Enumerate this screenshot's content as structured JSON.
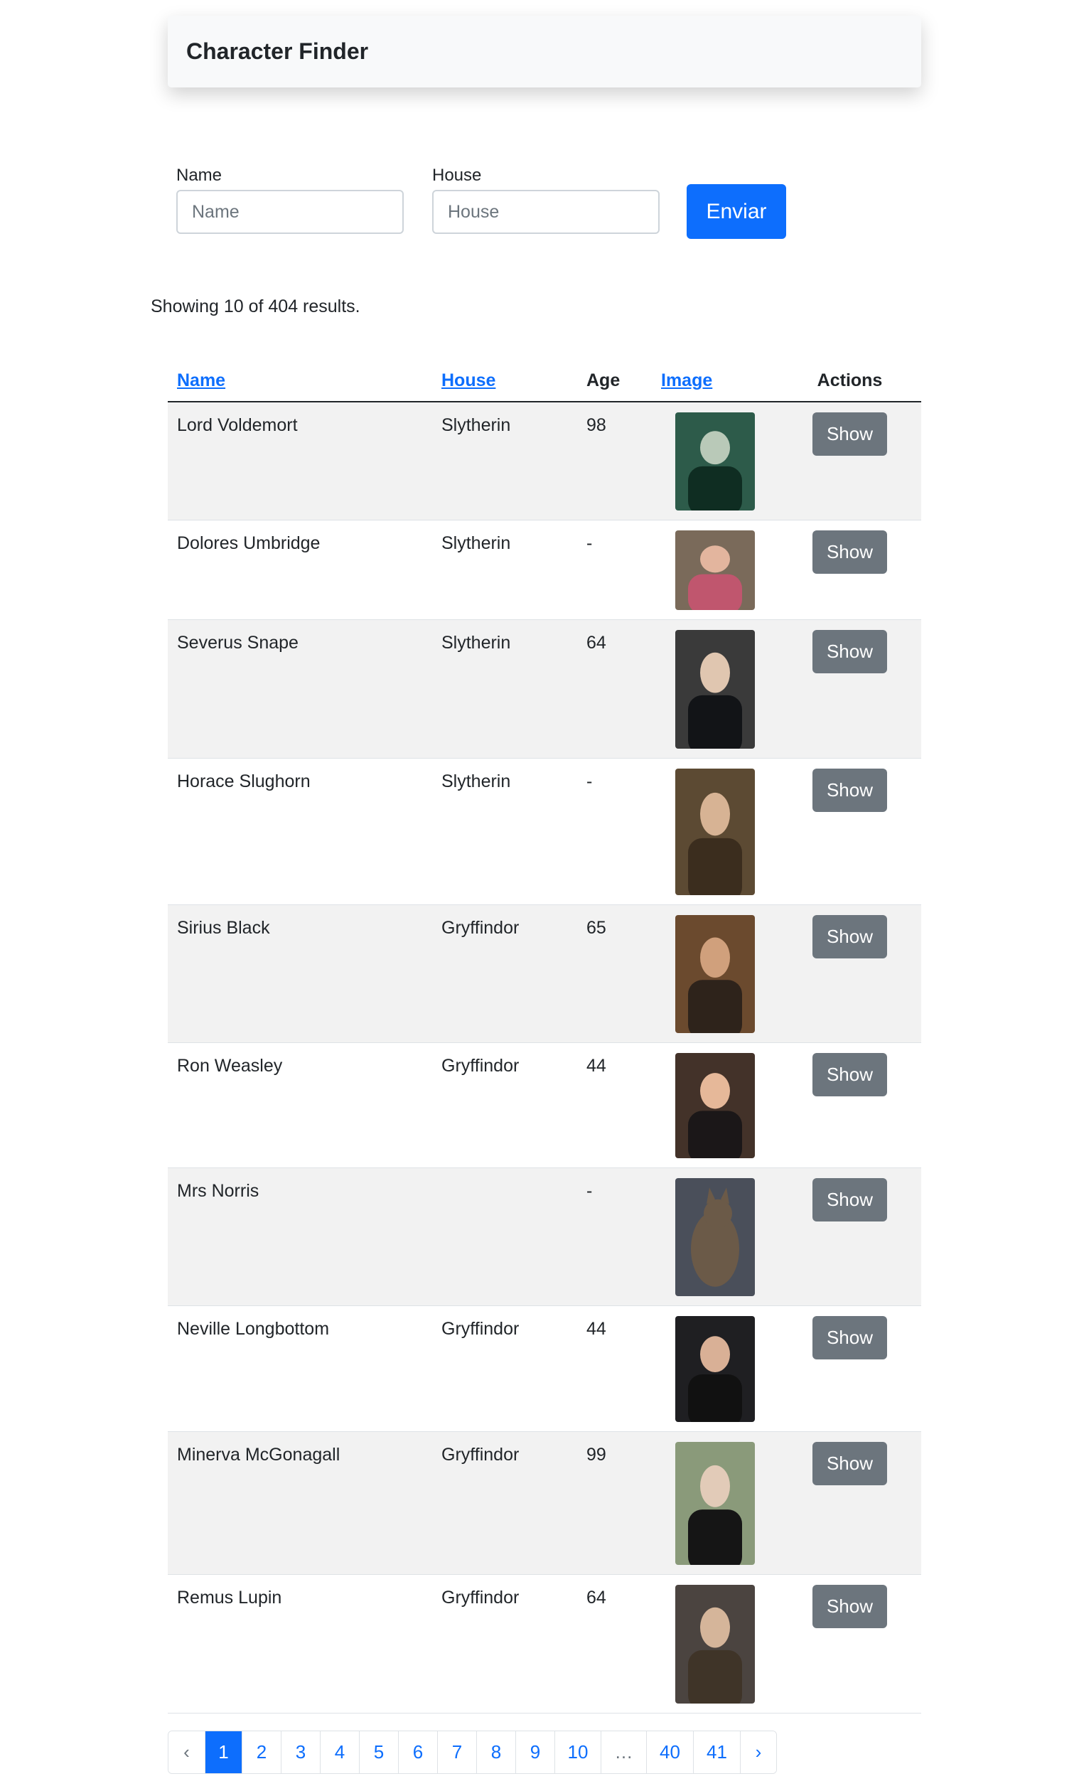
{
  "navbar": {
    "brand": "Character Finder"
  },
  "search": {
    "name_label": "Name",
    "name_placeholder": "Name",
    "house_label": "House",
    "house_placeholder": "House",
    "submit_label": "Enviar"
  },
  "results": {
    "summary": "Showing 10 of 404 results."
  },
  "table": {
    "headers": {
      "name": "Name",
      "house": "House",
      "age": "Age",
      "image": "Image",
      "actions": "Actions"
    },
    "rows": [
      {
        "name": "Lord Voldemort",
        "house": "Slytherin",
        "age": "98",
        "action": "Show",
        "portrait_icon": "character-portrait"
      },
      {
        "name": "Dolores Umbridge",
        "house": "Slytherin",
        "age": "-",
        "action": "Show",
        "portrait_icon": "character-portrait"
      },
      {
        "name": "Severus Snape",
        "house": "Slytherin",
        "age": "64",
        "action": "Show",
        "portrait_icon": "character-portrait"
      },
      {
        "name": "Horace Slughorn",
        "house": "Slytherin",
        "age": "-",
        "action": "Show",
        "portrait_icon": "character-portrait"
      },
      {
        "name": "Sirius Black",
        "house": "Gryffindor",
        "age": "65",
        "action": "Show",
        "portrait_icon": "character-portrait"
      },
      {
        "name": "Ron Weasley",
        "house": "Gryffindor",
        "age": "44",
        "action": "Show",
        "portrait_icon": "character-portrait"
      },
      {
        "name": "Mrs Norris",
        "house": "",
        "age": "-",
        "action": "Show",
        "portrait_icon": "cat-portrait"
      },
      {
        "name": "Neville Longbottom",
        "house": "Gryffindor",
        "age": "44",
        "action": "Show",
        "portrait_icon": "character-portrait"
      },
      {
        "name": "Minerva McGonagall",
        "house": "Gryffindor",
        "age": "99",
        "action": "Show",
        "portrait_icon": "character-portrait"
      },
      {
        "name": "Remus Lupin",
        "house": "Gryffindor",
        "age": "64",
        "action": "Show",
        "portrait_icon": "character-portrait"
      }
    ]
  },
  "pagination": {
    "prev": "‹",
    "next": "›",
    "current": "1",
    "pages": [
      "1",
      "2",
      "3",
      "4",
      "5",
      "6",
      "7",
      "8",
      "9",
      "10",
      "…",
      "40",
      "41"
    ]
  },
  "colors": {
    "primary": "#0d6efd",
    "secondary": "#6c757d",
    "stripe": "#f2f2f2"
  }
}
